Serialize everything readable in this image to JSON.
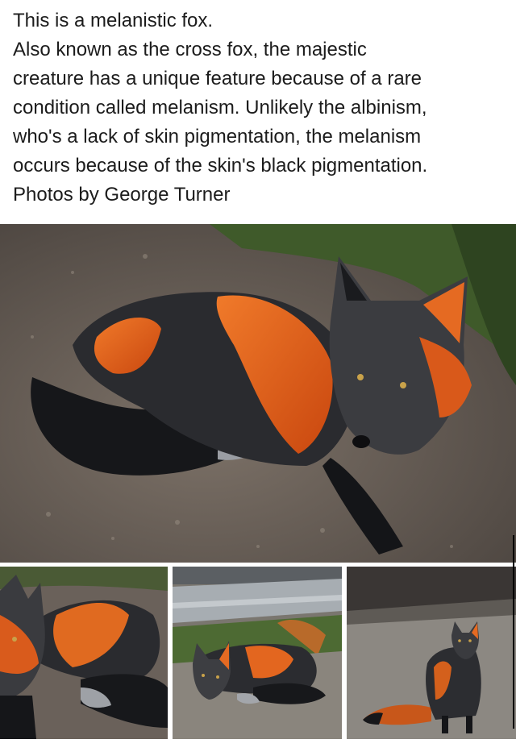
{
  "post": {
    "lines": [
      "This is a melanistic fox.",
      "Also known as the cross fox, the majestic",
      "creature has a unique feature because of a rare",
      "condition called melanism. Unlikely the albinism,",
      "who's a lack of skin pigmentation, the melanism",
      "occurs because of the skin's black pigmentation.",
      "Photos by George Turner"
    ]
  },
  "colors": {
    "background": "#ffffff",
    "text": "#1c1c1c",
    "fox_orange": "#e8621a",
    "fox_dark": "#1a1b1e",
    "ground": "#6f655c",
    "foliage": "#3f5a2a"
  },
  "images": {
    "main": "photo-melanistic-fox-lying",
    "thumbs": [
      "photo-fox-closeup-left",
      "photo-fox-by-guardrail",
      "photo-fox-standing-road"
    ]
  }
}
